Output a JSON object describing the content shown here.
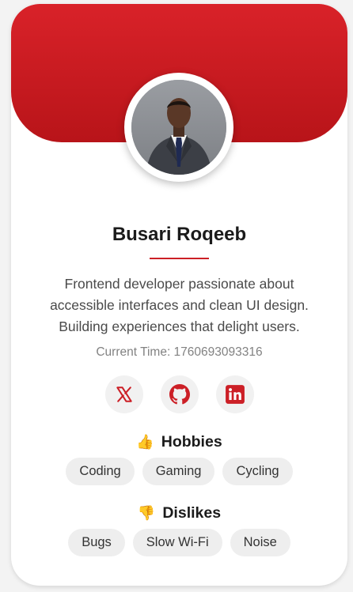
{
  "profile": {
    "name": "Busari Roqeeb",
    "bio": "Frontend developer passionate about accessible interfaces and clean UI design. Building experiences that delight users.",
    "current_time": "Current Time: 1760693093316",
    "avatar_alt": "Busari Roqeeb"
  },
  "socials": [
    {
      "network": "X",
      "icon": "x-icon"
    },
    {
      "network": "GitHub",
      "icon": "github-icon"
    },
    {
      "network": "LinkedIn",
      "icon": "linkedin-icon"
    }
  ],
  "hobbies": {
    "emoji": "👍",
    "title": "Hobbies",
    "items": [
      "Coding",
      "Gaming",
      "Cycling"
    ]
  },
  "dislikes": {
    "emoji": "👎",
    "title": "Dislikes",
    "items": [
      "Bugs",
      "Slow Wi-Fi",
      "Noise"
    ]
  },
  "colors": {
    "accent": "#cc1f26",
    "banner_top": "#d92229",
    "banner_bottom": "#b81419",
    "chip_bg": "#eeeeee",
    "emoji_yellow": "#f2b134"
  }
}
